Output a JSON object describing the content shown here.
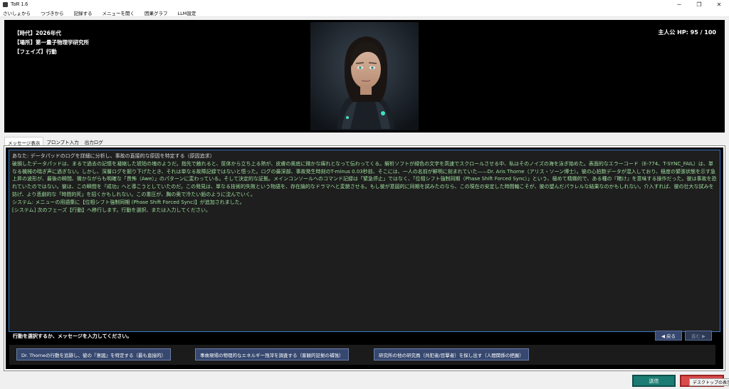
{
  "window": {
    "title": "ToR 1.6",
    "controls": {
      "minimize": "─",
      "maximize": "❐",
      "close": "✕"
    }
  },
  "menu": [
    "さいしょから",
    "つづきから",
    "記録する",
    "メニューを開く",
    "因果グラフ",
    "LLM設定"
  ],
  "status": {
    "era": "【時代】2026年代",
    "place": "【場所】第一量子物理学研究所",
    "phase": "【フェイズ】行動",
    "hp": "主人公 HP: 95 / 100"
  },
  "tabs": [
    "メッセージ表示",
    "プロンプト入力",
    "出力ログ"
  ],
  "log": {
    "user_line": "あなた: データパッドのログを詳細に分析し、事故の直接的な原因を特定する（原因追求）",
    "narrative": "破損したデータパッドは、まるで過去の記憶を凝縮した琥珀の塊のようだ。指先で触れると、筐体から立ち上る熱が、皮膚の奥底に微かな痺れとなって伝わってくる。解析ソフトが緑色の文字を高速でスクロールさせる中、私はそのノイズの海を泳ぎ始めた。表面的なエラーコード（E-774、T-SYNC_FAIL）は、単なる機械の喘ぎ声に過ぎない。しかし、深層ログを掘り下げたとき、それは単なる故障記録ではないと悟った。ログの最深部、事故発生時刻のT-minus 0.03秒前、そこには、一人の名前が鮮明に刻まれていた——Dr. Aris Thorne（アリス・ソーン博士）。彼の心拍数データが混入しており、極度の緊張状態を示す急上昇の波形が、最後の瞬間、微かながらも明確な「畏怖（Awe）」のパターンに変わっている。そして決定的な証拠。メインコンソールへのコマンド記録は「緊急停止」ではなく、「位相シフト強制同期（Phase Shift Forced Sync）」という、極めて精緻的で、ある種の『賭け』を意味する操作だった。彼は事故を恐れていたのではない。彼は、この瞬間を『成功』へと導こうとしていたのだ。この発見は、単なる技術的失敗という物語を、存在論的なドラマへと変貌させる。もし彼が意図的に同期を試みたのなら、この現在の安定した時間軸こそが、彼の望んだパラレルな結果なのかもしれない。介入すれば、彼の壮大な試みを妨げ、より悲劇的な「時間的死」を招くかもしれない。この重圧が、胸の奥で冷たい鉛のように沈んでいく。",
    "system_line": "システム: メニューの用語集に【位相シフト強制同期 (Phase Shift Forced Sync)】が追加されました。",
    "phase_line": "[システム] 次のフェーズ【行動】へ移行します。行動を選択、または入力してください。"
  },
  "prompt": "行動を選択するか、メッセージを入力してください。",
  "nav": {
    "back": "◀ 戻る",
    "forward": "進む ▶"
  },
  "choices": [
    "Dr. Thorneの行動を追跡し、彼の『意図』を特定する（最も直接的）",
    "事故現場の物理的なエネルギー残滓を調査する（客観的証拠の補強）",
    "研究所の他の研究員（共犯者/目撃者）を探し出す（人間関係の把握）"
  ],
  "buttons": {
    "send": "送信"
  },
  "tooltip": "デスクトップの表示",
  "colors": {
    "accent": "#36486f",
    "send": "#1c7c73",
    "danger": "#d94a4a",
    "log_text": "#9fe09f"
  }
}
